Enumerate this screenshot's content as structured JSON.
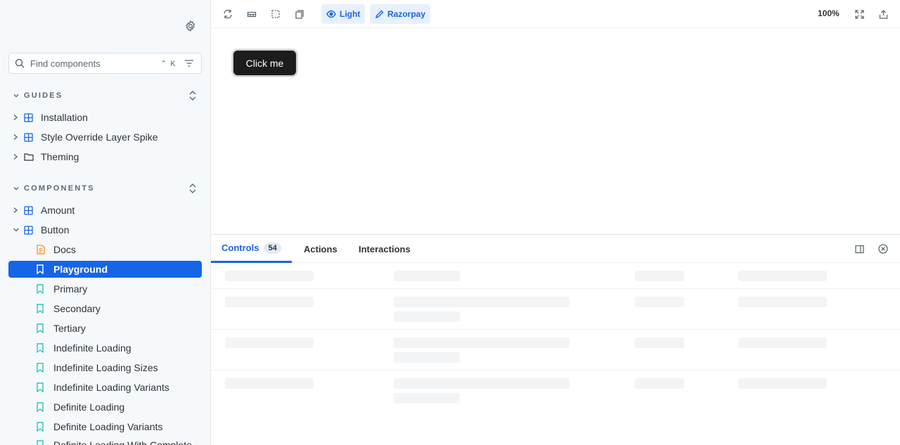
{
  "sidebar": {
    "search_placeholder": "Find components",
    "shortcut": "⌃ K",
    "guides_header": "GUIDES",
    "guides": [
      {
        "label": "Installation"
      },
      {
        "label": "Style Override Layer Spike"
      },
      {
        "label": "Theming"
      }
    ],
    "components_header": "COMPONENTS",
    "components": [
      {
        "label": "Amount"
      },
      {
        "label": "Button"
      }
    ],
    "button_children": [
      {
        "label": "Docs"
      },
      {
        "label": "Playground"
      },
      {
        "label": "Primary"
      },
      {
        "label": "Secondary"
      },
      {
        "label": "Tertiary"
      },
      {
        "label": "Indefinite Loading"
      },
      {
        "label": "Indefinite Loading Sizes"
      },
      {
        "label": "Indefinite Loading Variants"
      },
      {
        "label": "Definite Loading"
      },
      {
        "label": "Definite Loading Variants"
      },
      {
        "label": "Definite Loading With Complete"
      }
    ]
  },
  "toolbar": {
    "theme_label": "Light",
    "brand_label": "Razorpay",
    "zoom": "100%"
  },
  "canvas": {
    "button_label": "Click me"
  },
  "panel": {
    "tabs": [
      {
        "label": "Controls",
        "count": "54"
      },
      {
        "label": "Actions"
      },
      {
        "label": "Interactions"
      }
    ]
  },
  "colors": {
    "accent": "#1565e8",
    "sidebar_bg": "#f6f9fc",
    "story_icon": "#2ec4b6",
    "docs_icon": "#ff8c1a",
    "component_icon": "#1565e8"
  }
}
